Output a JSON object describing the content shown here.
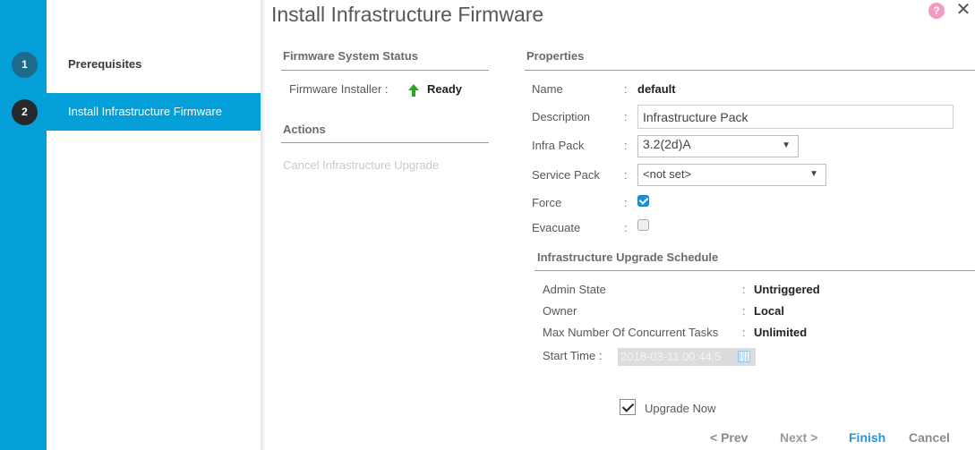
{
  "wizard": {
    "steps": [
      {
        "number": "1",
        "label": "Prerequisites",
        "active": false
      },
      {
        "number": "2",
        "label": "Install Infrastructure Firmware",
        "active": true
      }
    ]
  },
  "header": {
    "title": "Install Infrastructure Firmware",
    "help_icon": "?",
    "close_icon": "✕"
  },
  "firmware_status": {
    "section_title": "Firmware System Status",
    "installer_label": "Firmware Installer :",
    "installer_status": "Ready",
    "status_icon": "up-arrow-green",
    "status_color": "#2aa52a"
  },
  "actions": {
    "section_title": "Actions",
    "items": [
      {
        "label": "Cancel Infrastructure Upgrade",
        "enabled": false
      }
    ]
  },
  "properties": {
    "section_title": "Properties",
    "name": {
      "label": "Name",
      "value": "default"
    },
    "description": {
      "label": "Description",
      "value": "Infrastructure Pack"
    },
    "infra_pack": {
      "label": "Infra Pack",
      "selected": "3.2(2d)A"
    },
    "service_pack": {
      "label": "Service Pack",
      "selected": "<not set>"
    },
    "force": {
      "label": "Force",
      "checked": true
    },
    "evacuate": {
      "label": "Evacuate",
      "checked": false
    },
    "colon": ":"
  },
  "schedule": {
    "section_title": "Infrastructure Upgrade Schedule",
    "admin_state": {
      "label": "Admin State",
      "value": "Untriggered"
    },
    "owner": {
      "label": "Owner",
      "value": "Local"
    },
    "max_tasks": {
      "label": "Max Number Of Concurrent Tasks",
      "value": "Unlimited"
    },
    "start_time": {
      "label": "Start Time :",
      "value": "2018-03-11 00:44:5"
    },
    "upgrade_now": {
      "label": "Upgrade Now",
      "checked": true
    }
  },
  "footer": {
    "prev": "< Prev",
    "next": "Next >",
    "finish": "Finish",
    "cancel": "Cancel"
  },
  "colors": {
    "accent": "#049fd9",
    "finish_link": "#1e9ad6",
    "help_badge": "#f49ac1"
  }
}
